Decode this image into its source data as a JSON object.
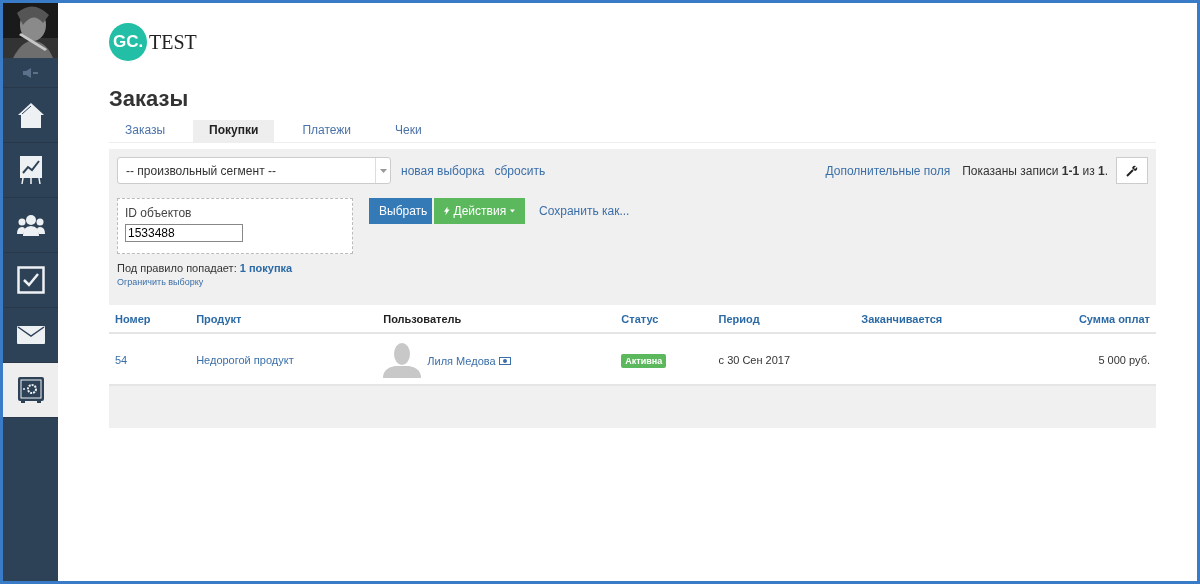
{
  "sidebar": {
    "items": [
      {
        "kind": "home",
        "selected": false
      },
      {
        "kind": "chart",
        "selected": false
      },
      {
        "kind": "people",
        "selected": false
      },
      {
        "kind": "check",
        "selected": false
      },
      {
        "kind": "mail",
        "selected": false
      },
      {
        "kind": "safe",
        "selected": true
      }
    ]
  },
  "logo": {
    "mark": "GC.",
    "text": "TEST"
  },
  "page_title": "Заказы",
  "tabs": [
    {
      "label": "Заказы",
      "selected": false
    },
    {
      "label": "Покупки",
      "selected": true
    },
    {
      "label": "Платежи",
      "selected": false
    },
    {
      "label": "Чеки",
      "selected": false
    }
  ],
  "filter": {
    "segment": "-- произвольный сегмент --",
    "links": [
      "новая выборка",
      "сбросить"
    ],
    "extra_fields": "Дополнительные поля",
    "records_info": "Показаны записи **1-1** из **1**.",
    "id_label": "ID объектов",
    "id_value": "1533488",
    "select_button": "Выбрать",
    "actions_button": "Действия",
    "save_as": "Сохранить как...",
    "rule_text": "Под правило попадает:",
    "rule_link": "1 покупка",
    "limit_link": "Ограничить выборку"
  },
  "table": {
    "columns": [
      "Номер",
      "Продукт",
      "Пользователь",
      "Статус",
      "Период",
      "Заканчивается",
      "Сумма оплат"
    ],
    "rows": [
      {
        "number": "54",
        "product": "Недорогой продукт",
        "user": "Лиля Медова",
        "status": "Активна",
        "period": "с 30 Сен 2017",
        "sum": "5 000 руб."
      }
    ]
  }
}
